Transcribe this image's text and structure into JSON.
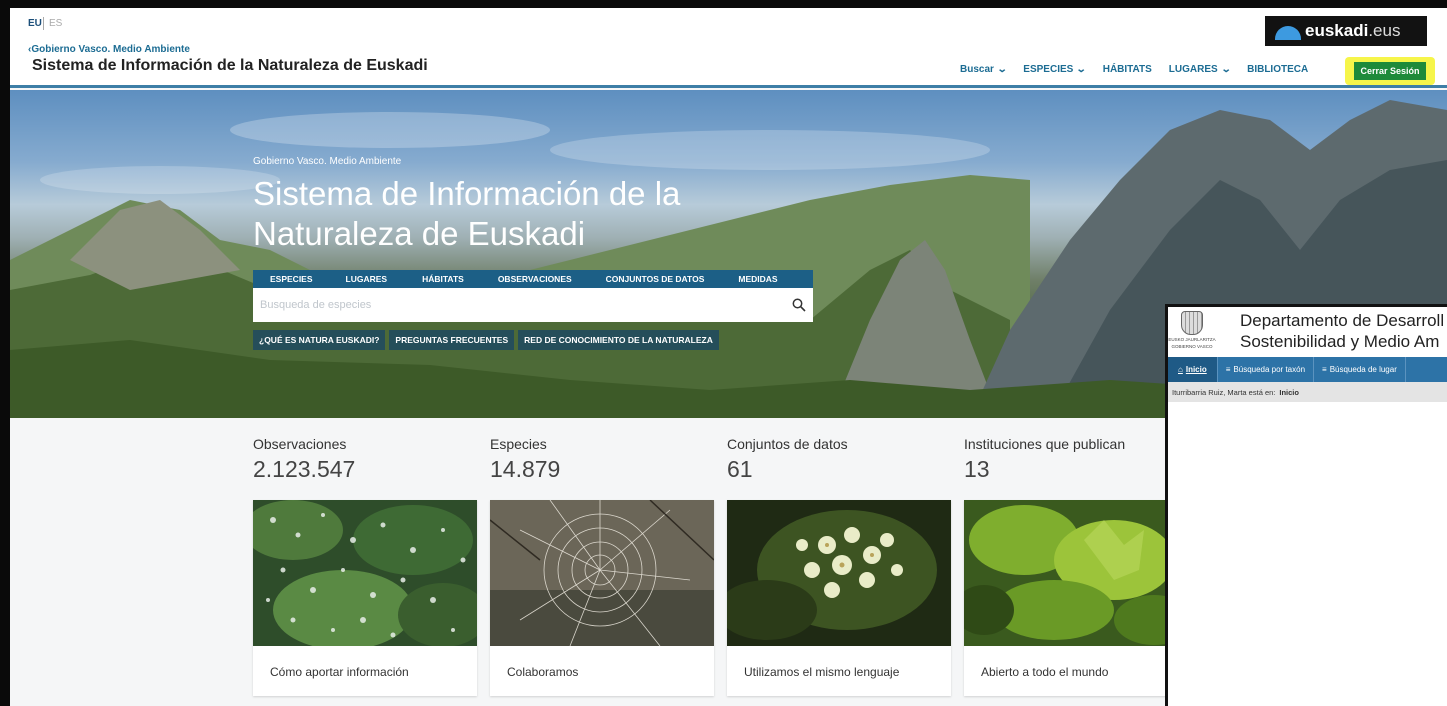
{
  "lang": {
    "eu": "EU",
    "es": "ES"
  },
  "header": {
    "gov_link": "‹Gobierno Vasco. Medio Ambiente",
    "site_title": "Sistema de Información de la Naturaleza de Euskadi",
    "logo_main": "euskadi",
    "logo_tld": ".eus",
    "nav": [
      {
        "label": "Buscar",
        "has_menu": true
      },
      {
        "label": "ESPECIES",
        "has_menu": true
      },
      {
        "label": "HÁBITATS",
        "has_menu": false
      },
      {
        "label": "LUGARES",
        "has_menu": true
      },
      {
        "label": "BIBLIOTECA",
        "has_menu": false
      }
    ],
    "logout_label": "Cerrar Sesión",
    "highlight_color": "#f6f54a"
  },
  "hero": {
    "subtitle": "Gobierno Vasco. Medio Ambiente",
    "title": "Sistema de Información de la Naturaleza de Euskadi",
    "tabs": [
      "ESPECIES",
      "LUGARES",
      "HÁBITATS",
      "OBSERVACIONES",
      "CONJUNTOS DE DATOS",
      "MEDIDAS"
    ],
    "search_placeholder": "Busqueda de especies",
    "links": [
      "¿QUÉ ES NATURA EUSKADI?",
      "PREGUNTAS FRECUENTES",
      "RED DE CONOCIMIENTO DE LA NATURALEZA"
    ]
  },
  "stats": [
    {
      "label": "Observaciones",
      "value": "2.123.547"
    },
    {
      "label": "Especies",
      "value": "14.879"
    },
    {
      "label": "Conjuntos de datos",
      "value": "61"
    },
    {
      "label": "Instituciones que publican",
      "value": "13"
    }
  ],
  "cards": [
    {
      "label": "Cómo aportar información",
      "image": "dew-drops-leaves"
    },
    {
      "label": "Colaboramos",
      "image": "spider-web"
    },
    {
      "label": "Utilizamos el mismo lenguaje",
      "image": "white-flowers"
    },
    {
      "label": "Abierto a todo el mundo",
      "image": "oak-leaves"
    }
  ],
  "overlay": {
    "seal_text_1": "EUSKO JAURLARITZA",
    "seal_text_2": "GOBIERNO VASCO",
    "dept_line1": "Departamento de Desarroll",
    "dept_line2": "Sostenibilidad y Medio Am",
    "nav": [
      "Inicio",
      "Búsqueda por taxón",
      "Búsqueda de lugar"
    ],
    "crumb_prefix": "Iturribarria Ruiz, Marta está en:",
    "crumb_location": "Inicio"
  },
  "colors": {
    "brand_blue": "#1c5f86",
    "link_blue": "#1c6c93",
    "logout_green": "#1e8a3a"
  }
}
